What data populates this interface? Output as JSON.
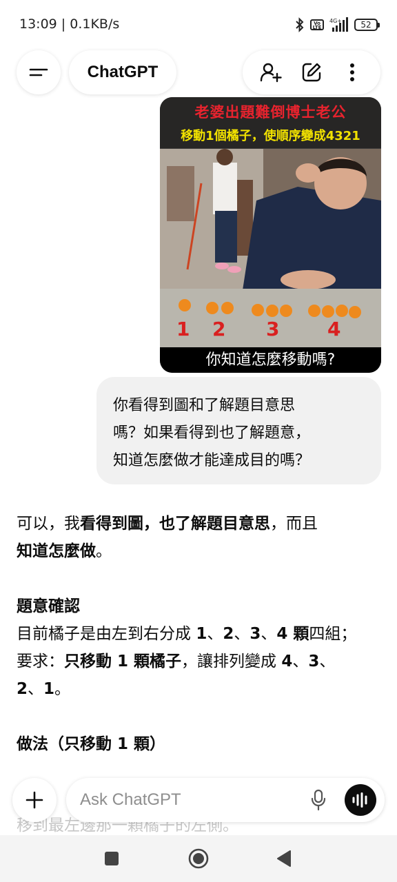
{
  "status_bar": {
    "time_speed": "13:09 | 0.1KB/s",
    "volte": "Vo LTE",
    "network": "4G+",
    "battery": "52"
  },
  "header": {
    "title": "ChatGPT"
  },
  "image": {
    "caption_top": "老婆出題難倒博士老公",
    "caption_mid": "移動1個橘子，使順序變成4321",
    "labels": [
      "1",
      "2",
      "3",
      "4"
    ],
    "caption_bottom": "你知道怎麼移動嗎?"
  },
  "user_message": {
    "lines": [
      "你看得到圖和了解題目意思",
      "嗎？如果看得到也了解題意，",
      "知道怎麼做才能達成目的嗎？"
    ]
  },
  "assistant": {
    "p1": {
      "a": "可以，我",
      "b": "看得到圖，也了解題目意思",
      "c": "，而且",
      "d": "知道怎麼做",
      "e": "。"
    },
    "heading1": "題意確認",
    "p2": {
      "a": "目前橘子是由左到右分成 ",
      "b": "1",
      "c": "、",
      "d": "2",
      "e": "、",
      "f": "3",
      "g": "、",
      "h": "4 顆",
      "i": "四組；"
    },
    "p3": {
      "a": "要求：",
      "b": "只移動 1 顆橘子",
      "c": "，讓排列變成 ",
      "d": "4",
      "e": "、",
      "f": "3",
      "g": "、",
      "h": "2",
      "i": "、",
      "j": "1",
      "k": "。"
    },
    "heading2": "做法（只移動 1 顆）",
    "faded_line": "移到最左邊那一顆橘子的左側。"
  },
  "composer": {
    "placeholder": "Ask ChatGPT"
  }
}
